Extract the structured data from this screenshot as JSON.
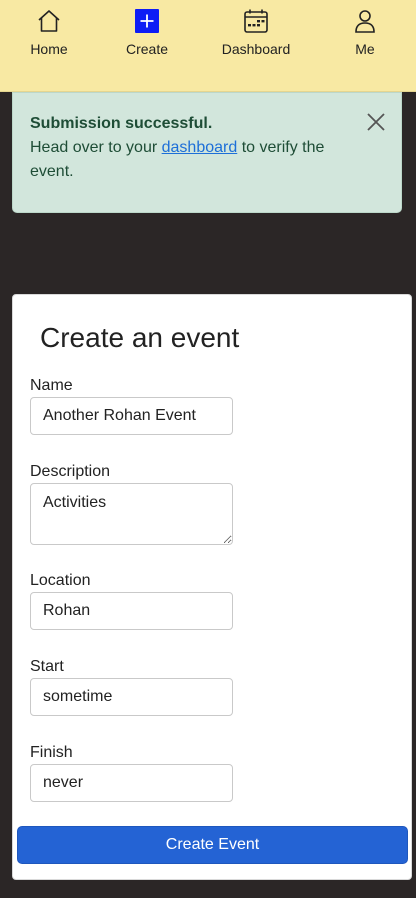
{
  "nav": {
    "items": [
      {
        "label": "Home",
        "icon": "home-icon"
      },
      {
        "label": "Create",
        "icon": "plus-square-icon"
      },
      {
        "label": "Dashboard",
        "icon": "calendar-icon"
      },
      {
        "label": "Me",
        "icon": "person-icon"
      }
    ],
    "accent": "#0d1cf5",
    "background": "#f8e9a3"
  },
  "alert": {
    "title": "Submission successful.",
    "text_before": "Head over to your ",
    "link": "dashboard",
    "text_after": " to verify the event.",
    "background": "#d2e6dc"
  },
  "form": {
    "title": "Create an event",
    "fields": [
      {
        "label": "Name",
        "value": "Another Rohan Event"
      },
      {
        "label": "Description",
        "value": "Activities"
      },
      {
        "label": "Location",
        "value": "Rohan"
      },
      {
        "label": "Start",
        "value": "sometime"
      },
      {
        "label": "Finish",
        "value": "never"
      }
    ],
    "submit_label": "Create Event",
    "submit_color": "#2463d4"
  }
}
